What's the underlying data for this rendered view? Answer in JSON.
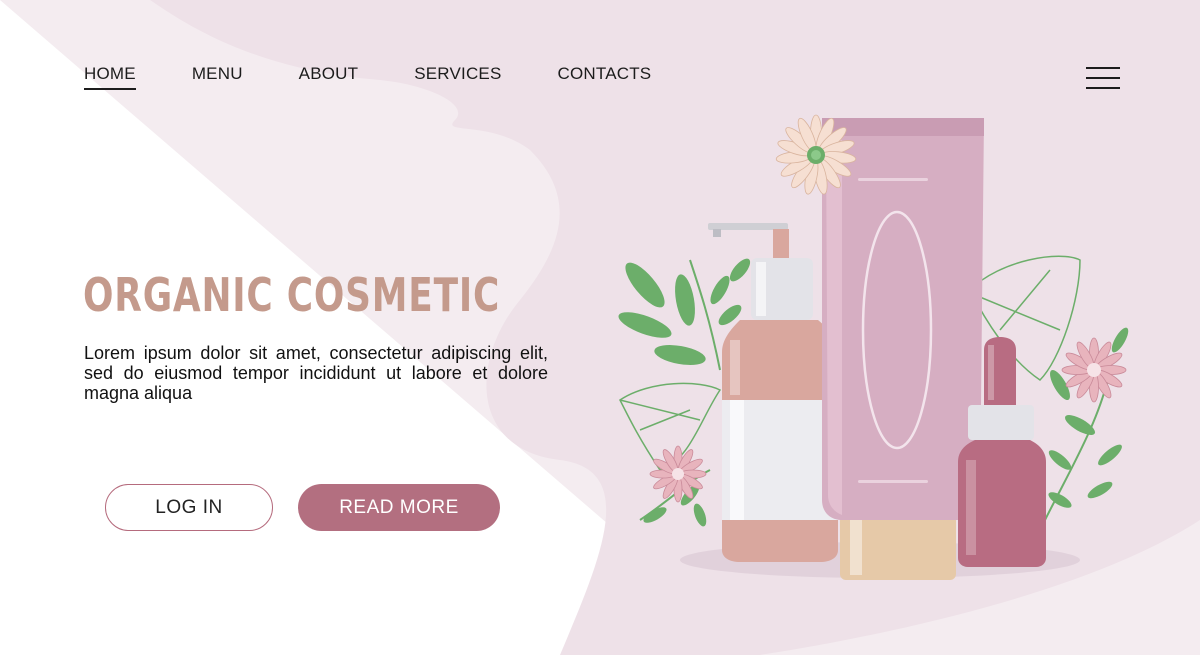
{
  "nav": {
    "items": [
      {
        "label": "HOME",
        "active": true
      },
      {
        "label": "MENU",
        "active": false
      },
      {
        "label": "ABOUT",
        "active": false
      },
      {
        "label": "SERVICES",
        "active": false
      },
      {
        "label": "CONTACTS",
        "active": false
      }
    ],
    "menu_icon": "hamburger-menu-icon"
  },
  "hero": {
    "title": "ORGANIC COSMETIC",
    "description": "Lorem ipsum dolor sit amet, consectetur adipiscing elit, sed do eiusmod tempor incididunt ut labore et dolore magna aliqua",
    "login_label": "LOG IN",
    "read_more_label": "READ MORE"
  },
  "colors": {
    "accent": "#b36f80",
    "title": "#c49a8c",
    "background_shape": "#eee1e8",
    "tube": "#d6aec2",
    "bottle": "#d9a79e",
    "serum": "#b86c82",
    "leaf": "#6cae6a"
  },
  "illustration": {
    "items": [
      "pump-bottle",
      "cream-tube",
      "serum-dropper-bottle",
      "flower-icon",
      "leaf-icon",
      "monstera-leaf-icon"
    ]
  }
}
